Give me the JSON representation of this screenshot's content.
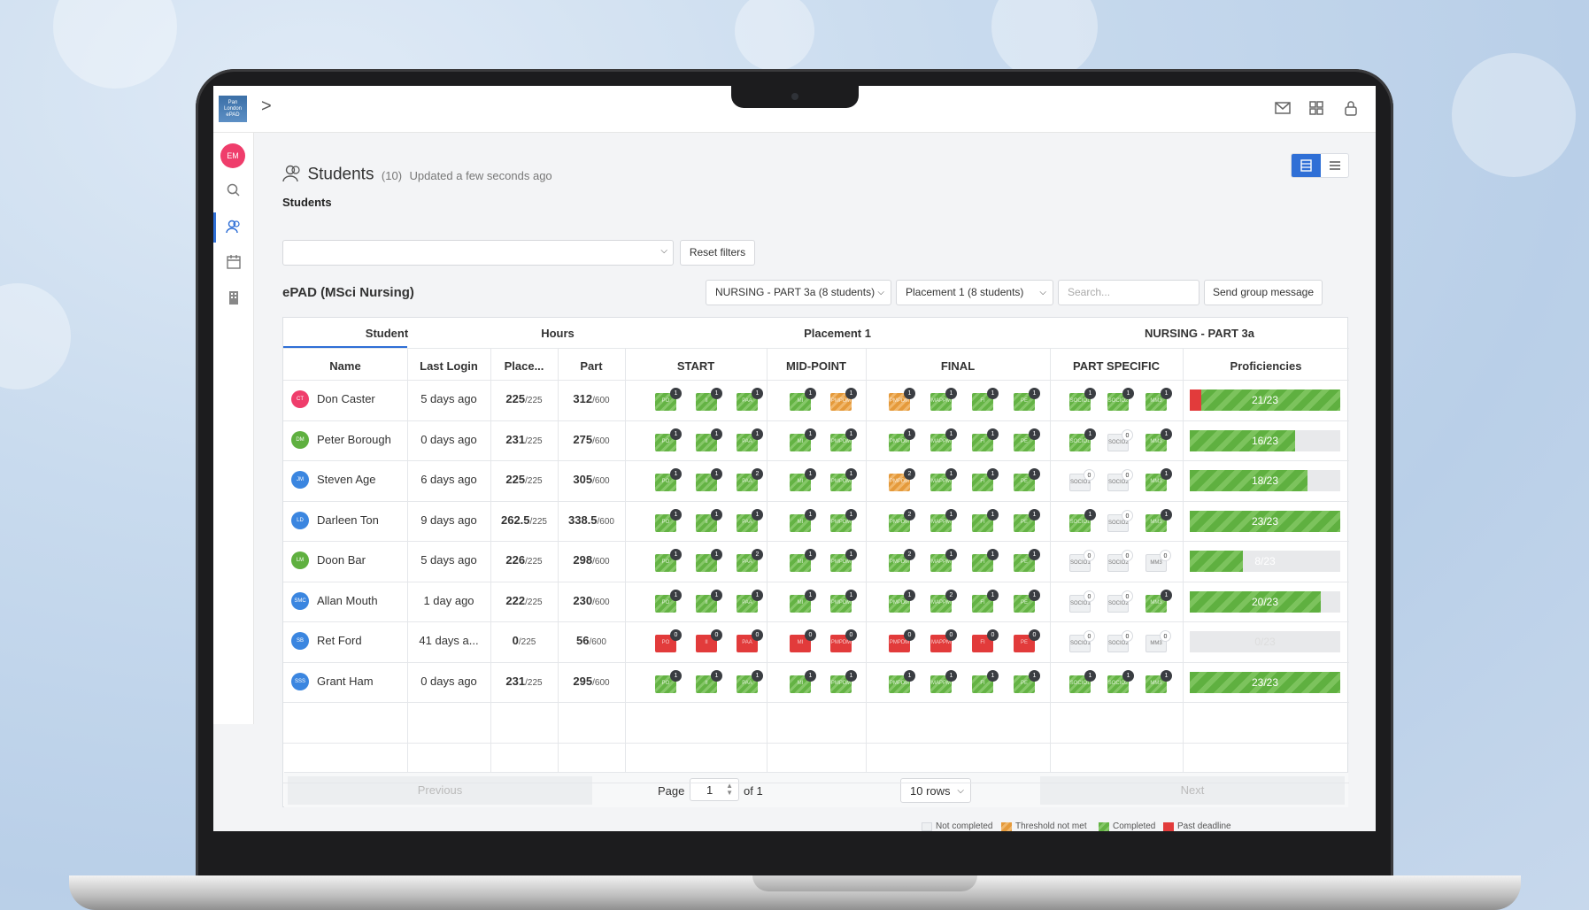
{
  "app": {
    "logo_text": "Pan London ePAD"
  },
  "user": {
    "initials": "EM"
  },
  "header": {
    "title": "Students",
    "count": "(10)",
    "updated": "Updated a few seconds ago",
    "breadcrumb": "Students"
  },
  "filters": {
    "reset_label": "Reset filters",
    "part_select": "NURSING - PART 3a (8 students)",
    "placement_select": "Placement 1 (8 students)",
    "search_placeholder": "Search...",
    "send_label": "Send group message"
  },
  "section": {
    "title": "ePAD (MSci Nursing)"
  },
  "table": {
    "groups": {
      "student": "Student",
      "hours": "Hours",
      "placement": "Placement 1",
      "part": "NURSING - PART 3a"
    },
    "columns": {
      "name": "Name",
      "last_login": "Last Login",
      "place": "Place...",
      "part": "Part",
      "start": "START",
      "mid": "MID-POINT",
      "final": "FINAL",
      "part_specific": "PART SPECIFIC",
      "proficiencies": "Proficiencies"
    },
    "rows": [
      {
        "initials": "CT",
        "color": "#ef3d6b",
        "name": "Don Caster",
        "last_login": "5 days ago",
        "place_h": "225",
        "place_t": "/225",
        "part_h": "312",
        "part_t": "/600",
        "start": [
          [
            "g",
            "PO",
            "1"
          ],
          [
            "g",
            "II",
            "1"
          ],
          [
            "g",
            "PAA",
            "1"
          ]
        ],
        "mid": [
          [
            "g",
            "MI",
            "1"
          ],
          [
            "o",
            "PMPDM",
            "1"
          ]
        ],
        "final": [
          [
            "o",
            "PMPDM",
            "1"
          ],
          [
            "g",
            "MAPPM",
            "1"
          ],
          [
            "g",
            "FI",
            "1"
          ],
          [
            "g",
            "PE",
            "1"
          ]
        ],
        "ps": [
          [
            "g",
            "SOCIO1",
            "1"
          ],
          [
            "g",
            "SOCIO2",
            "1"
          ],
          [
            "g",
            "MM3",
            "1"
          ]
        ],
        "prog": "21/23",
        "prog_pct": 100,
        "prog_red": true
      },
      {
        "initials": "DM",
        "color": "#5fb040",
        "name": "Peter Borough",
        "last_login": "0 days ago",
        "place_h": "231",
        "place_t": "/225",
        "part_h": "275",
        "part_t": "/600",
        "start": [
          [
            "g",
            "PO",
            "1"
          ],
          [
            "g",
            "II",
            "1"
          ],
          [
            "g",
            "PAA",
            "1"
          ]
        ],
        "mid": [
          [
            "g",
            "MI",
            "1"
          ],
          [
            "g",
            "PMPDM",
            "1"
          ]
        ],
        "final": [
          [
            "g",
            "PMPDM",
            "1"
          ],
          [
            "g",
            "MAPPM",
            "1"
          ],
          [
            "g",
            "FI",
            "1"
          ],
          [
            "g",
            "PE",
            "1"
          ]
        ],
        "ps": [
          [
            "g",
            "SOCIO1",
            "1"
          ],
          [
            "n",
            "SOCIO2",
            "0"
          ],
          [
            "g",
            "MM3",
            "1"
          ]
        ],
        "prog": "16/23",
        "prog_pct": 70,
        "prog_red": false
      },
      {
        "initials": "JM",
        "color": "#3b86e0",
        "name": "Steven Age",
        "last_login": "6 days ago",
        "place_h": "225",
        "place_t": "/225",
        "part_h": "305",
        "part_t": "/600",
        "start": [
          [
            "g",
            "PO",
            "1"
          ],
          [
            "g",
            "II",
            "1"
          ],
          [
            "g",
            "PAA",
            "2"
          ]
        ],
        "mid": [
          [
            "g",
            "MI",
            "1"
          ],
          [
            "g",
            "PMPDM",
            "1"
          ]
        ],
        "final": [
          [
            "o",
            "PMPDM",
            "2"
          ],
          [
            "g",
            "MAPPM",
            "1"
          ],
          [
            "g",
            "FI",
            "1"
          ],
          [
            "g",
            "PE",
            "1"
          ]
        ],
        "ps": [
          [
            "n",
            "SOCIO1",
            "0"
          ],
          [
            "n",
            "SOCIO2",
            "0"
          ],
          [
            "g",
            "MM3",
            "1"
          ]
        ],
        "prog": "18/23",
        "prog_pct": 78,
        "prog_red": false
      },
      {
        "initials": "LD",
        "color": "#3b86e0",
        "name": "Darleen Ton",
        "last_login": "9 days ago",
        "place_h": "262.5",
        "place_t": "/225",
        "part_h": "338.5",
        "part_t": "/600",
        "start": [
          [
            "g",
            "PO",
            "1"
          ],
          [
            "g",
            "II",
            "1"
          ],
          [
            "g",
            "PAA",
            "1"
          ]
        ],
        "mid": [
          [
            "g",
            "MI",
            "1"
          ],
          [
            "g",
            "PMPDM",
            "1"
          ]
        ],
        "final": [
          [
            "g",
            "PMPDM",
            "2"
          ],
          [
            "g",
            "MAPPM",
            "1"
          ],
          [
            "g",
            "FI",
            "1"
          ],
          [
            "g",
            "PE",
            "1"
          ]
        ],
        "ps": [
          [
            "g",
            "SOCIO1",
            "1"
          ],
          [
            "n",
            "SOCIO2",
            "0"
          ],
          [
            "g",
            "MM3",
            "1"
          ]
        ],
        "prog": "23/23",
        "prog_pct": 100,
        "prog_red": false
      },
      {
        "initials": "LM",
        "color": "#5fb040",
        "name": "Doon Bar",
        "last_login": "5 days ago",
        "place_h": "226",
        "place_t": "/225",
        "part_h": "298",
        "part_t": "/600",
        "start": [
          [
            "g",
            "PO",
            "1"
          ],
          [
            "g",
            "II",
            "1"
          ],
          [
            "g",
            "PAA",
            "2"
          ]
        ],
        "mid": [
          [
            "g",
            "MI",
            "1"
          ],
          [
            "g",
            "PMPDM",
            "1"
          ]
        ],
        "final": [
          [
            "g",
            "PMPDM",
            "2"
          ],
          [
            "g",
            "MAPPM",
            "1"
          ],
          [
            "g",
            "FI",
            "1"
          ],
          [
            "g",
            "PE",
            "1"
          ]
        ],
        "ps": [
          [
            "n",
            "SOCIO1",
            "0"
          ],
          [
            "n",
            "SOCIO2",
            "0"
          ],
          [
            "n",
            "MM3",
            "0"
          ]
        ],
        "prog": "8/23",
        "prog_pct": 35,
        "prog_red": false
      },
      {
        "initials": "SMC",
        "color": "#3b86e0",
        "name": "Allan Mouth",
        "last_login": "1 day ago",
        "place_h": "222",
        "place_t": "/225",
        "part_h": "230",
        "part_t": "/600",
        "start": [
          [
            "g",
            "PO",
            "1"
          ],
          [
            "g",
            "II",
            "1"
          ],
          [
            "g",
            "PAA",
            "1"
          ]
        ],
        "mid": [
          [
            "g",
            "MI",
            "1"
          ],
          [
            "g",
            "PMPDM",
            "1"
          ]
        ],
        "final": [
          [
            "g",
            "PMPDM",
            "1"
          ],
          [
            "g",
            "MAPPM",
            "2"
          ],
          [
            "g",
            "FI",
            "1"
          ],
          [
            "g",
            "PE",
            "1"
          ]
        ],
        "ps": [
          [
            "n",
            "SOCIO1",
            "0"
          ],
          [
            "n",
            "SOCIO2",
            "0"
          ],
          [
            "g",
            "MM3",
            "1"
          ]
        ],
        "prog": "20/23",
        "prog_pct": 87,
        "prog_red": false
      },
      {
        "initials": "SB",
        "color": "#3b86e0",
        "name": "Ret Ford",
        "last_login": "41 days a...",
        "place_h": "0",
        "place_t": "/225",
        "part_h": "56",
        "part_t": "/600",
        "start": [
          [
            "r",
            "PO",
            "0"
          ],
          [
            "r",
            "II",
            "0"
          ],
          [
            "r",
            "PAA",
            "0"
          ]
        ],
        "mid": [
          [
            "r",
            "MI",
            "0"
          ],
          [
            "r",
            "PMPDM",
            "0"
          ]
        ],
        "final": [
          [
            "r",
            "PMPDM",
            "0"
          ],
          [
            "r",
            "MAPPM",
            "0"
          ],
          [
            "r",
            "FI",
            "0"
          ],
          [
            "r",
            "PE",
            "0"
          ]
        ],
        "ps": [
          [
            "n",
            "SOCIO1",
            "0"
          ],
          [
            "n",
            "SOCIO2",
            "0"
          ],
          [
            "n",
            "MM3",
            "0"
          ]
        ],
        "prog": "0/23",
        "prog_pct": 0,
        "prog_red": false
      },
      {
        "initials": "SSS",
        "color": "#3b86e0",
        "name": "Grant Ham",
        "last_login": "0 days ago",
        "place_h": "231",
        "place_t": "/225",
        "part_h": "295",
        "part_t": "/600",
        "start": [
          [
            "g",
            "PO",
            "1"
          ],
          [
            "g",
            "II",
            "1"
          ],
          [
            "g",
            "PAA",
            "1"
          ]
        ],
        "mid": [
          [
            "g",
            "MI",
            "1"
          ],
          [
            "g",
            "PMPDM",
            "1"
          ]
        ],
        "final": [
          [
            "g",
            "PMPDM",
            "1"
          ],
          [
            "g",
            "MAPPM",
            "1"
          ],
          [
            "g",
            "FI",
            "1"
          ],
          [
            "g",
            "PE",
            "1"
          ]
        ],
        "ps": [
          [
            "g",
            "SOCIO1",
            "1"
          ],
          [
            "g",
            "SOCIO2",
            "1"
          ],
          [
            "g",
            "MM3",
            "1"
          ]
        ],
        "prog": "23/23",
        "prog_pct": 100,
        "prog_red": false
      }
    ]
  },
  "pagination": {
    "previous": "Previous",
    "page_label": "Page",
    "page_value": "1",
    "of_label": "of 1",
    "rows_select": "10 rows",
    "next": "Next"
  },
  "legend": {
    "not_completed": "Not completed",
    "threshold": "Threshold not met",
    "completed": "Completed",
    "past_deadline": "Past deadline"
  },
  "colors": {
    "accent": "#2f6fd6",
    "completed": "#64b344",
    "threshold": "#e59a3b",
    "past_deadline": "#e23b3b"
  }
}
